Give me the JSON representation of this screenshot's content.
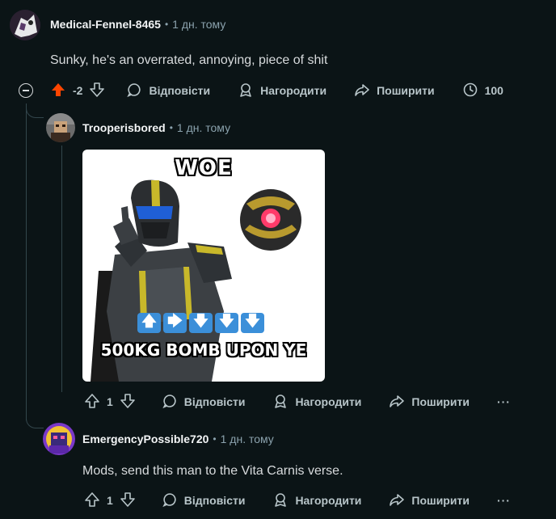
{
  "comments": [
    {
      "author": "Medical-Fennel-8465",
      "time": "1 дн. тому",
      "text": "Sunky, he's an overrated, annoying, piece of shit",
      "score": "-2",
      "actions": {
        "reply": "Відповісти",
        "award": "Нагородити",
        "share": "Поширити",
        "views": "100"
      }
    },
    {
      "author": "Trooperisbored",
      "time": "1 дн. тому",
      "meme": {
        "top_text": "WOE",
        "arrows": [
          "🡅",
          "🡆",
          "🡇",
          "🡇",
          "🡇"
        ],
        "bottom_text": "500KG BOMB UPON YE"
      },
      "score": "1",
      "actions": {
        "reply": "Відповісти",
        "award": "Нагородити",
        "share": "Поширити",
        "more": "···"
      }
    },
    {
      "author": "EmergencyPossible720",
      "time": "1 дн. тому",
      "text": "Mods, send this man to the Vita Carnis verse.",
      "score": "1",
      "actions": {
        "reply": "Відповісти",
        "award": "Нагородити",
        "share": "Поширити",
        "more": "···"
      }
    }
  ],
  "colors": {
    "background": "#0b1416",
    "downvote_active": "#ff4500",
    "thread_line": "#33464c"
  },
  "icons": {
    "upvote": "upvote-icon",
    "downvote": "downvote-icon",
    "reply": "comment-bubble-icon",
    "award": "award-icon",
    "share": "share-icon",
    "views": "views-clock-icon",
    "collapse": "collapse-minus-icon",
    "more": "more-dots-icon"
  }
}
